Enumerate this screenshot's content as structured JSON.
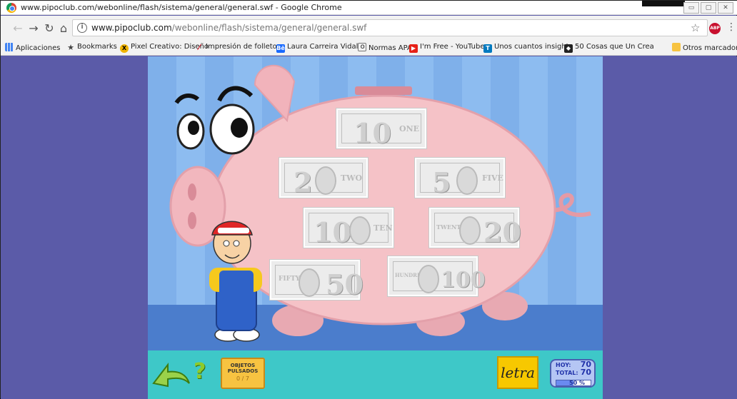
{
  "window": {
    "title": "www.pipoclub.com/webonline/flash/sistema/general/general.swf - Google Chrome",
    "controls": {
      "minimize": "▭",
      "maximize": "▢",
      "close": "✕"
    }
  },
  "addressbar": {
    "url_host": "www.pipoclub.com",
    "url_path": "/webonline/flash/sistema/general/general.swf",
    "info": "i",
    "abp": "ABP"
  },
  "bookmarks": [
    {
      "label": "Aplicaciones",
      "icon": "apps-icon"
    },
    {
      "label": "Bookmarks",
      "icon": "star-icon"
    },
    {
      "label": "Pixel Creativo: Diseño",
      "icon": "pixel-creativo-icon"
    },
    {
      "label": "Impresión de folletos",
      "icon": "impresion-icon"
    },
    {
      "label": "Laura Carreira Vidal o",
      "icon": "behance-icon"
    },
    {
      "label": "Normas APA",
      "icon": "document-icon"
    },
    {
      "label": "I'm Free - YouTube",
      "icon": "youtube-icon"
    },
    {
      "label": "Unos cuantos insights",
      "icon": "trello-icon"
    },
    {
      "label": "50 Cosas que Un Crea",
      "icon": "bookmark-icon"
    },
    {
      "label": "Otros marcadores",
      "icon": "folder-icon"
    }
  ],
  "bills": [
    {
      "value": "10",
      "word": "ONE"
    },
    {
      "value": "2",
      "word": "TWO"
    },
    {
      "value": "5",
      "word": "FIVE"
    },
    {
      "value": "10",
      "word": "TEN"
    },
    {
      "value": "20",
      "word": "TWENTY"
    },
    {
      "value": "50",
      "word": "FIFTY"
    },
    {
      "value": "100",
      "word": "HUNDRED"
    }
  ],
  "game": {
    "objects_label_1": "OBJETOS",
    "objects_label_2": "PULSADOS",
    "objects_count": "0 / 7",
    "help": "?",
    "letra": "letra",
    "score": {
      "hoy_label": "HOY:",
      "hoy_value": "70",
      "total_label": "TOTAL:",
      "total_value": "70",
      "progress": "50",
      "pct": "%"
    },
    "colors": {
      "pig": "#f5c2c7",
      "stage": "#8dbcf0",
      "bar": "#3ec8c8"
    }
  }
}
